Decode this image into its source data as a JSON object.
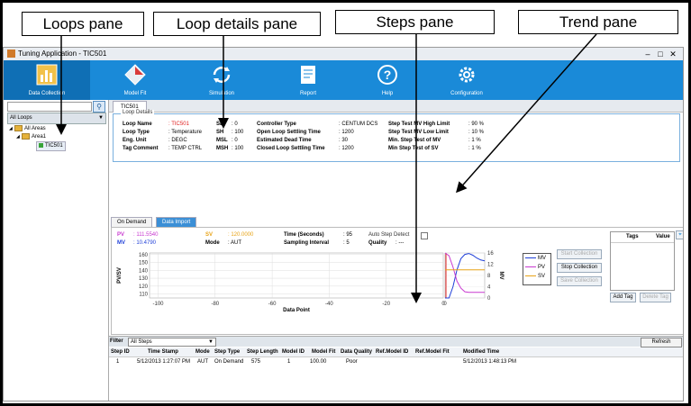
{
  "callouts": {
    "loops": "Loops pane",
    "loop_details": "Loop details pane",
    "steps": "Steps pane",
    "trend": "Trend pane"
  },
  "window": {
    "title": "Tuning Application - TIC501",
    "minimize": "–",
    "maximize": "□",
    "close": "✕"
  },
  "ribbon": [
    {
      "label": "Data Collection",
      "icon": "data-collection-icon"
    },
    {
      "label": "Model Fit",
      "icon": "model-fit-icon"
    },
    {
      "label": "Simulation",
      "icon": "simulation-icon"
    },
    {
      "label": "Report",
      "icon": "report-icon"
    },
    {
      "label": "Help",
      "icon": "help-icon"
    },
    {
      "label": "Configuration",
      "icon": "configuration-icon"
    }
  ],
  "loops_pane": {
    "filter": "All Loops",
    "tree": [
      {
        "label": "All Areas",
        "level": 0
      },
      {
        "label": "Area1",
        "level": 1
      },
      {
        "label": "TIC501",
        "level": 2
      }
    ]
  },
  "tab": "TIC501",
  "loop_details": {
    "title": "Loop Details",
    "col1": [
      {
        "label": "Loop Name",
        "value": ": TIC501"
      },
      {
        "label": "Loop Type",
        "value": ": Temperature"
      },
      {
        "label": "Eng. Unit",
        "value": ": DEGC"
      },
      {
        "label": "Tag Comment",
        "value": ": TEMP CTRL"
      }
    ],
    "col2": [
      {
        "label": "SL",
        "value": ": 0"
      },
      {
        "label": "SH",
        "value": ": 100"
      },
      {
        "label": "MSL",
        "value": ": 0"
      },
      {
        "label": "MSH",
        "value": ": 100"
      }
    ],
    "col3": [
      {
        "label": "Controller Type",
        "value": ": CENTUM DCS"
      },
      {
        "label": "Open Loop Settling Time",
        "value": ": 1200"
      },
      {
        "label": "Estimated Dead Time",
        "value": ": 30"
      },
      {
        "label": "Closed Loop Settling Time",
        "value": ": 1200"
      }
    ],
    "col4": [
      {
        "label": "Step Test MV High Limit",
        "value": ": 90 %"
      },
      {
        "label": "Step Test MV Low Limit",
        "value": ": 10 %"
      },
      {
        "label": "Min. Step Test of MV",
        "value": ": 1 %"
      },
      {
        "label": "Min Step Test of SV",
        "value": ": 1 %"
      }
    ]
  },
  "trend_tabs": [
    "On Demand",
    "Data Import"
  ],
  "trend": {
    "pv_label": "PV",
    "pv_value": ": 111.5540",
    "mv_label": "MV",
    "mv_value": ": 10.4790",
    "sv_label": "SV",
    "sv_value": ": 120.0000",
    "mode_label": "Mode",
    "mode_value": ": AUT",
    "time_label": "Time (Seconds)",
    "time_value": ": 95",
    "interval_label": "Sampling Interval",
    "interval_value": ": 5",
    "autostep_label": "Auto Step Detect",
    "quality_label": "Quality",
    "quality_value": ": ---",
    "buttons": {
      "start": "Start Collection",
      "stop": "Stop Collection",
      "save": "Save Collection"
    },
    "tags_header": "Tags",
    "value_header": "Value",
    "add_tag": "Add Tag",
    "delete_tag": "Delete Tag"
  },
  "chart_data": {
    "type": "line",
    "ylabel": "PV/SV",
    "xlabel": "Data Point",
    "y_ticks": [
      "160",
      "150",
      "140",
      "130",
      "120",
      "110"
    ],
    "x_ticks": [
      "-100",
      "-80",
      "-60",
      "-40",
      "-20",
      "0"
    ],
    "y2_label": "MV",
    "y2_ticks": [
      "16",
      "12",
      "8",
      "4",
      "0"
    ],
    "ylim": [
      105,
      162
    ],
    "xlim": [
      -103,
      0
    ],
    "y2lim": [
      0,
      16
    ],
    "series_colors": {
      "MV": "#1f3fd8",
      "PV": "#c83ad0",
      "SV": "#e8a317"
    },
    "legend": [
      "MV",
      "PV",
      "SV"
    ],
    "series": [
      {
        "name": "MV",
        "x": [
          0,
          2,
          4,
          6,
          8,
          10,
          12,
          14,
          16,
          18,
          20
        ],
        "y": [
          0,
          0,
          4,
          10,
          14,
          15.5,
          15.8,
          15.2,
          14.2,
          13.5,
          13.2
        ]
      },
      {
        "name": "PV",
        "x": [
          0,
          2,
          4,
          6,
          8,
          10,
          12,
          14,
          16,
          18,
          20
        ],
        "y": [
          16,
          15,
          11,
          6,
          3.5,
          2.2,
          2,
          2,
          2,
          2,
          2
        ]
      },
      {
        "name": "SV",
        "x": [
          0,
          20
        ],
        "y": [
          10,
          10
        ]
      }
    ]
  },
  "steps_pane": {
    "filter_label": "Filter",
    "filter_value": "All Steps",
    "refresh": "Refresh",
    "columns": [
      "Step ID",
      "Time Stamp",
      "Mode",
      "Step Type",
      "Step Length",
      "Model ID",
      "Model Fit",
      "Data Quality",
      "Ref.Model ID",
      "Ref.Model Fit",
      "Modified Time"
    ],
    "rows": [
      [
        "1",
        "5/12/2013 1:27:07 PM",
        "AUT",
        "On Demand",
        "575",
        "1",
        "100.00",
        "Poor",
        "",
        "",
        "5/12/2013 1:48:13 PM"
      ]
    ]
  }
}
